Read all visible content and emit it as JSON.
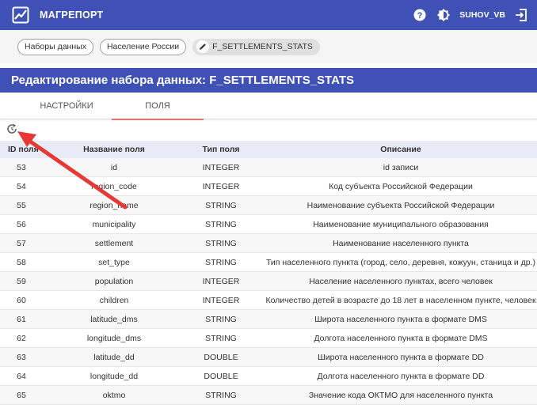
{
  "app": {
    "title": "МАГРЕПОРТ",
    "username": "SUHOV_VB",
    "accent": "#3f51b5"
  },
  "topbar": {
    "icons": [
      "logo-icon",
      "help-icon",
      "theme-toggle-icon",
      "logout-icon"
    ]
  },
  "breadcrumb": {
    "items": [
      "Наборы данных",
      "Население России"
    ],
    "current": "F_SETTLEMENTS_STATS"
  },
  "page": {
    "title": "Редактирование набора данных: F_SETTLEMENTS_STATS"
  },
  "tabs": [
    {
      "label": "НАСТРОЙКИ",
      "active": false
    },
    {
      "label": "ПОЛЯ",
      "active": true
    }
  ],
  "table": {
    "headers": [
      "ID поля",
      "Название поля",
      "Тип поля",
      "Описание"
    ],
    "rows": [
      [
        "53",
        "id",
        "INTEGER",
        "id записи"
      ],
      [
        "54",
        "region_code",
        "INTEGER",
        "Код субъекта Российской Федерации"
      ],
      [
        "55",
        "region_name",
        "STRING",
        "Наименование субъекта Российской Федерации"
      ],
      [
        "56",
        "municipality",
        "STRING",
        "Наименование муниципального образования"
      ],
      [
        "57",
        "settlement",
        "STRING",
        "Наименование населенного пункта"
      ],
      [
        "58",
        "set_type",
        "STRING",
        "Тип населенного пункта (город, село, деревня, кожуун, станица и др.)"
      ],
      [
        "59",
        "population",
        "INTEGER",
        "Население населенного пунктах, всего человек"
      ],
      [
        "60",
        "children",
        "INTEGER",
        "Количество детей в возрасте до 18 лет в населенном пункте, человек"
      ],
      [
        "61",
        "latitude_dms",
        "STRING",
        "Широта населенного пункта в формате DMS"
      ],
      [
        "62",
        "longitude_dms",
        "STRING",
        "Долгота населенного пункта в формате DMS"
      ],
      [
        "63",
        "latitude_dd",
        "DOUBLE",
        "Широта населенного пункта в формате DD"
      ],
      [
        "64",
        "longitude_dd",
        "DOUBLE",
        "Долгота населенного пункта в формате DD"
      ],
      [
        "65",
        "oktmo",
        "STRING",
        "Значение кода ОКТМО для населенного пункта"
      ]
    ]
  }
}
